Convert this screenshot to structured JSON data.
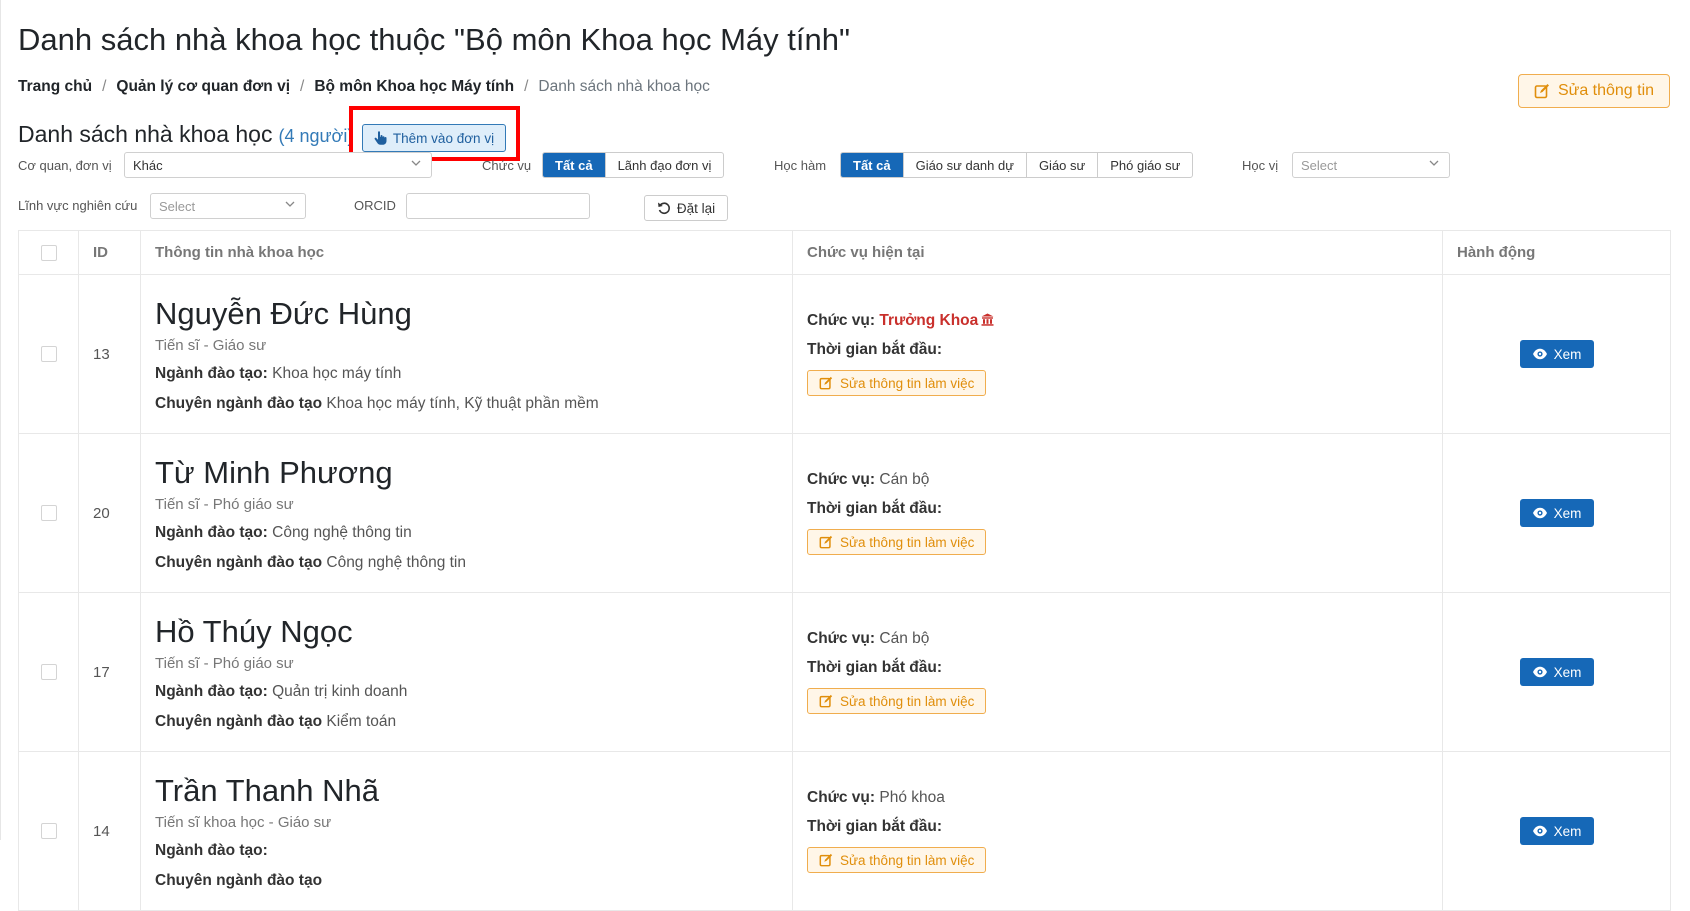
{
  "page": {
    "title": "Danh sách nhà khoa học thuộc \"Bộ môn Khoa học Máy tính\""
  },
  "breadcrumb": {
    "items": [
      "Trang chủ",
      "Quản lý cơ quan đơn vị",
      "Bộ môn Khoa học Máy tính"
    ],
    "separator": "/",
    "current": "Danh sách nhà khoa học"
  },
  "header": {
    "edit_button_label": "Sửa thông tin",
    "edit_button_icon": "edit-icon"
  },
  "list": {
    "title": "Danh sách nhà khoa học",
    "count_label": "(4 người)",
    "add_button_label": "Thêm vào đơn vị",
    "add_button_icon": "hand-pointer-icon"
  },
  "filters": {
    "unit_label": "Cơ quan, đơn vị",
    "unit_value": "Khác",
    "position_label": "Chức vụ",
    "position_options": [
      "Tất cả",
      "Lãnh đạo đơn vị"
    ],
    "position_selected": "Tất cả",
    "academic_title_label": "Học hàm",
    "academic_title_options": [
      "Tất cả",
      "Giáo sư danh dự",
      "Giáo sư",
      "Phó giáo sư"
    ],
    "academic_title_selected": "Tất cả",
    "degree_label": "Học vị",
    "degree_placeholder": "Select",
    "field_label": "Lĩnh vực nghiên cứu",
    "field_placeholder": "Select",
    "orcid_label": "ORCID",
    "orcid_value": "",
    "reset_label": "Đặt lại"
  },
  "table": {
    "columns": {
      "id": "ID",
      "info": "Thông tin nhà khoa học",
      "position": "Chức vụ hiện tại",
      "action": "Hành động"
    },
    "labels": {
      "major": "Ngành đào tạo:",
      "specialization": "Chuyên ngành đào tạo",
      "position": "Chức vụ:",
      "start_time": "Thời gian bắt đầu:",
      "edit_work": "Sửa thông tin làm việc",
      "view": "Xem"
    },
    "rows": [
      {
        "id": "13",
        "name": "Nguyễn Đức Hùng",
        "degree": "Tiến sĩ - Giáo sư",
        "major": "Khoa học máy tính",
        "specialization": "Khoa học máy tính, Kỹ thuật phần mềm",
        "position": "Trưởng Khoa",
        "position_highlight": true,
        "start_time": ""
      },
      {
        "id": "20",
        "name": "Từ Minh Phương",
        "degree": "Tiến sĩ - Phó giáo sư",
        "major": "Công nghệ thông tin",
        "specialization": "Công nghệ thông tin",
        "position": "Cán bộ",
        "position_highlight": false,
        "start_time": ""
      },
      {
        "id": "17",
        "name": "Hồ Thúy Ngọc",
        "degree": "Tiến sĩ - Phó giáo sư",
        "major": "Quản trị kinh doanh",
        "specialization": "Kiểm toán",
        "position": "Cán bộ",
        "position_highlight": false,
        "start_time": ""
      },
      {
        "id": "14",
        "name": "Trần Thanh Nhã",
        "degree": "Tiến sĩ khoa học - Giáo sư",
        "major": "",
        "specialization": "",
        "position": "Phó khoa",
        "position_highlight": false,
        "start_time": ""
      }
    ]
  },
  "colors": {
    "primary": "#1668b7",
    "warning": "#f0ad4e",
    "highlight_box": "#ff0000",
    "position_red": "#c9302c"
  }
}
